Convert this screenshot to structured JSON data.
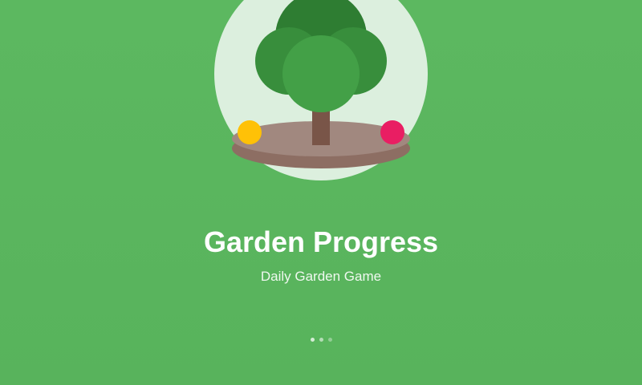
{
  "app": {
    "title": "Garden Progress",
    "subtitle": "Daily Garden Game"
  },
  "illustration": {
    "name": "tree-on-soil-illustration",
    "colors": {
      "background": "#5cb860",
      "halo": "#dcefde",
      "canopy_dark": "#2e7d32",
      "canopy_mid": "#388e3c",
      "canopy_light": "#43a047",
      "trunk": "#795548",
      "soil_top": "#a1887f",
      "soil_side": "#8d6e63",
      "fruit_left": "#ffc107",
      "fruit_right": "#e91e63"
    }
  },
  "pager": {
    "total": 3,
    "current": 1
  }
}
